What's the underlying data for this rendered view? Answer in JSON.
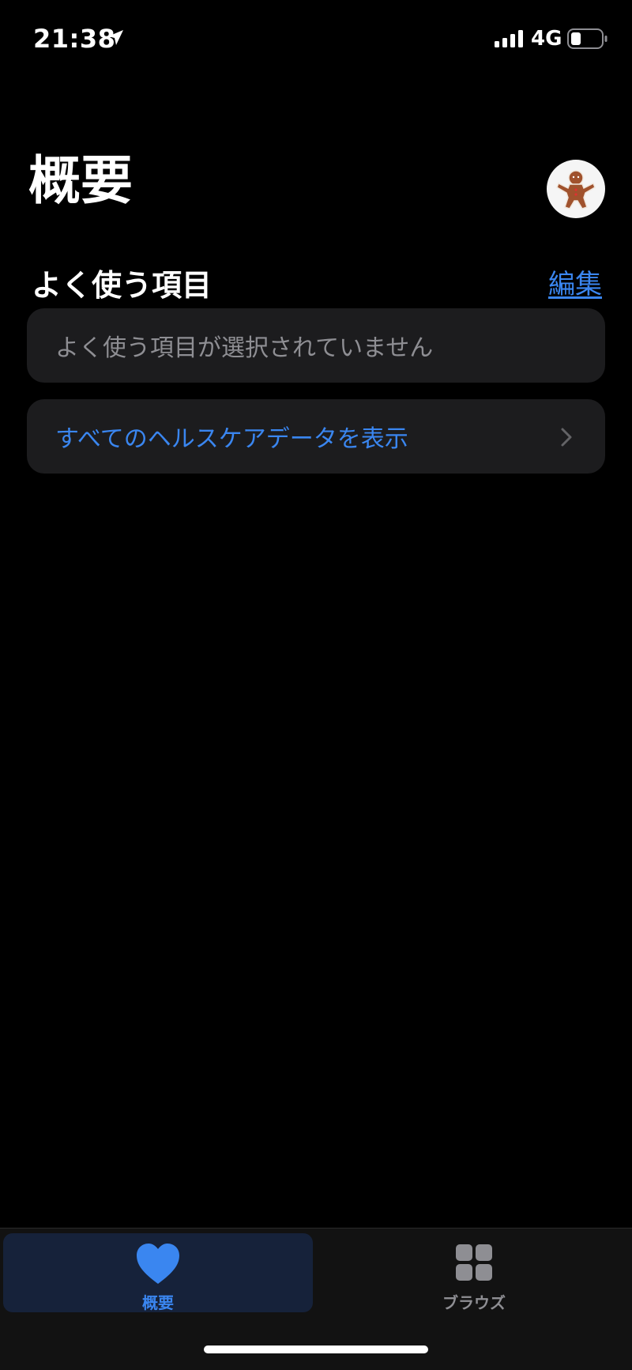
{
  "status_bar": {
    "time": "21:38",
    "network": "4G",
    "icons": [
      "location-arrow-icon",
      "cellular-signal-icon",
      "battery-icon"
    ]
  },
  "header": {
    "title": "概要",
    "avatar_icon": "gingerbread-avatar-icon"
  },
  "favorites": {
    "section_title": "よく使う項目",
    "edit_label": "編集",
    "empty_message": "よく使う項目が選択されていません"
  },
  "all_data": {
    "label": "すべてのヘルスケアデータを表示",
    "icon": "chevron-right-icon"
  },
  "tab_bar": {
    "tabs": [
      {
        "label": "概要",
        "icon": "heart-icon",
        "selected": true
      },
      {
        "label": "ブラウズ",
        "icon": "grid-icon",
        "selected": false
      }
    ]
  },
  "colors": {
    "background": "#000000",
    "card": "#1c1c1e",
    "accent": "#3a86f0",
    "secondary_text": "#8e8e93",
    "tab_bar": "#121212",
    "selected_tab": "#16223a"
  }
}
